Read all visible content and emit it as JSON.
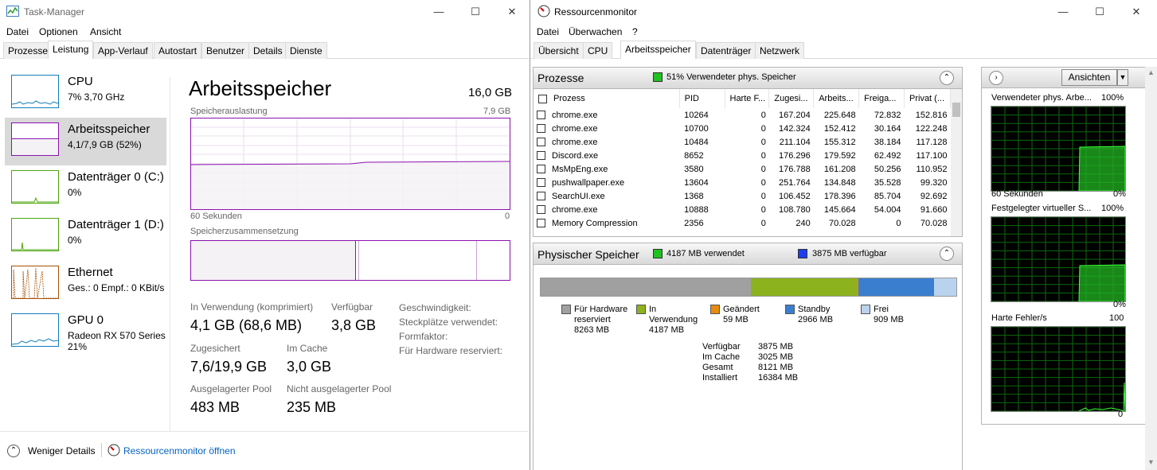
{
  "tm": {
    "title": "Task-Manager",
    "menu": [
      "Datei",
      "Optionen",
      "Ansicht"
    ],
    "tabs": [
      "Prozesse",
      "Leistung",
      "App-Verlauf",
      "Autostart",
      "Benutzer",
      "Details",
      "Dienste"
    ],
    "sidebar": [
      {
        "title": "CPU",
        "sub": "7%  3,70 GHz",
        "sub2": ""
      },
      {
        "title": "Arbeitsspeicher",
        "sub": "4,1/7,9 GB (52%)",
        "sub2": ""
      },
      {
        "title": "Datenträger 0 (C:)",
        "sub": "0%",
        "sub2": ""
      },
      {
        "title": "Datenträger 1 (D:)",
        "sub": "0%",
        "sub2": ""
      },
      {
        "title": "Ethernet",
        "sub": "Ges.: 0 Empf.: 0 KBit/s",
        "sub2": ""
      },
      {
        "title": "GPU 0",
        "sub": "Radeon RX 570 Series",
        "sub2": "21%"
      }
    ],
    "main": {
      "heading": "Arbeitsspeicher",
      "total": "16,0 GB",
      "usage_label": "Speicherauslastung",
      "usage_max": "7,9 GB",
      "time_label": "60 Sekunden",
      "time_zero": "0",
      "composition_label": "Speicherzusammensetzung",
      "usage_fraction": 0.52,
      "stats": {
        "in_use_label": "In Verwendung (komprimiert)",
        "in_use_value": "4,1 GB (68,6 MB)",
        "available_label": "Verfügbar",
        "available_value": "3,8 GB",
        "committed_label": "Zugesichert",
        "committed_value": "7,6/19,9 GB",
        "cached_label": "Im Cache",
        "cached_value": "3,0 GB",
        "paged_label": "Ausgelagerter Pool",
        "paged_value": "483 MB",
        "nonpaged_label": "Nicht ausgelagerter Pool",
        "nonpaged_value": "235 MB",
        "speed_label": "Geschwindigkeit:",
        "slots_label": "Steckplätze verwendet:",
        "form_label": "Formfaktor:",
        "hw_label": "Für Hardware reserviert:"
      }
    },
    "footer": {
      "fewer": "Weniger Details",
      "open_rm": "Ressourcenmonitor öffnen"
    }
  },
  "rm": {
    "title": "Ressourcenmonitor",
    "menu": [
      "Datei",
      "Überwachen",
      "?"
    ],
    "tabs": [
      "Übersicht",
      "CPU",
      "Arbeitsspeicher",
      "Datenträger",
      "Netzwerk"
    ],
    "proc_section": {
      "title": "Prozesse",
      "status": "51% Verwendeter phys. Speicher"
    },
    "columns": [
      "Prozess",
      "PID",
      "Harte F...",
      "Zugesi...",
      "Arbeits...",
      "Freiga...",
      "Privat (..."
    ],
    "rows": [
      [
        "chrome.exe",
        "10264",
        "0",
        "167.204",
        "225.648",
        "72.832",
        "152.816"
      ],
      [
        "chrome.exe",
        "10700",
        "0",
        "142.324",
        "152.412",
        "30.164",
        "122.248"
      ],
      [
        "chrome.exe",
        "10484",
        "0",
        "211.104",
        "155.312",
        "38.184",
        "117.128"
      ],
      [
        "Discord.exe",
        "8652",
        "0",
        "176.296",
        "179.592",
        "62.492",
        "117.100"
      ],
      [
        "MsMpEng.exe",
        "3580",
        "0",
        "176.788",
        "161.208",
        "50.256",
        "110.952"
      ],
      [
        "pushwallpaper.exe",
        "13604",
        "0",
        "251.764",
        "134.848",
        "35.528",
        "99.320"
      ],
      [
        "SearchUI.exe",
        "1368",
        "0",
        "106.452",
        "178.396",
        "85.704",
        "92.692"
      ],
      [
        "chrome.exe",
        "10888",
        "0",
        "108.780",
        "145.664",
        "54.004",
        "91.660"
      ],
      [
        "Memory Compression",
        "2356",
        "0",
        "240",
        "70.028",
        "0",
        "70.028"
      ]
    ],
    "phys_section": {
      "title": "Physischer Speicher",
      "used": "4187 MB verwendet",
      "avail": "3875 MB verfügbar"
    },
    "legend": [
      {
        "label1": "Für Hardware",
        "label2": "reserviert",
        "value": "8263 MB",
        "color": "#a0a0a0"
      },
      {
        "label1": "In",
        "label2": "Verwendung",
        "value": "4187 MB",
        "color": "#8cb21e"
      },
      {
        "label1": "Geändert",
        "label2": "",
        "value": "59 MB",
        "color": "#e88a0c"
      },
      {
        "label1": "Standby",
        "label2": "",
        "value": "2966 MB",
        "color": "#3a7fcf"
      },
      {
        "label1": "Frei",
        "label2": "",
        "value": "909 MB",
        "color": "#b9d3ee"
      }
    ],
    "summary": [
      {
        "label": "Verfügbar",
        "value": "3875 MB"
      },
      {
        "label": "Im Cache",
        "value": "3025 MB"
      },
      {
        "label": "Gesamt",
        "value": "8121 MB"
      },
      {
        "label": "Installiert",
        "value": "16384 MB"
      }
    ],
    "side_graphs": {
      "view_btn": "Ansichten",
      "g1_title": "Verwendeter phys. Arbe...",
      "g1_max": "100%",
      "g1_time": "60 Sekunden",
      "g1_min": "0%",
      "g2_title": "Festgelegter virtueller S...",
      "g2_max": "100%",
      "g2_min": "0%",
      "g3_title": "Harte Fehler/s",
      "g3_max": "100",
      "g3_min": "0"
    },
    "colors": {
      "used": "#1fc21f",
      "avail": "#1a3ef0",
      "accent": "#0563c1"
    }
  }
}
